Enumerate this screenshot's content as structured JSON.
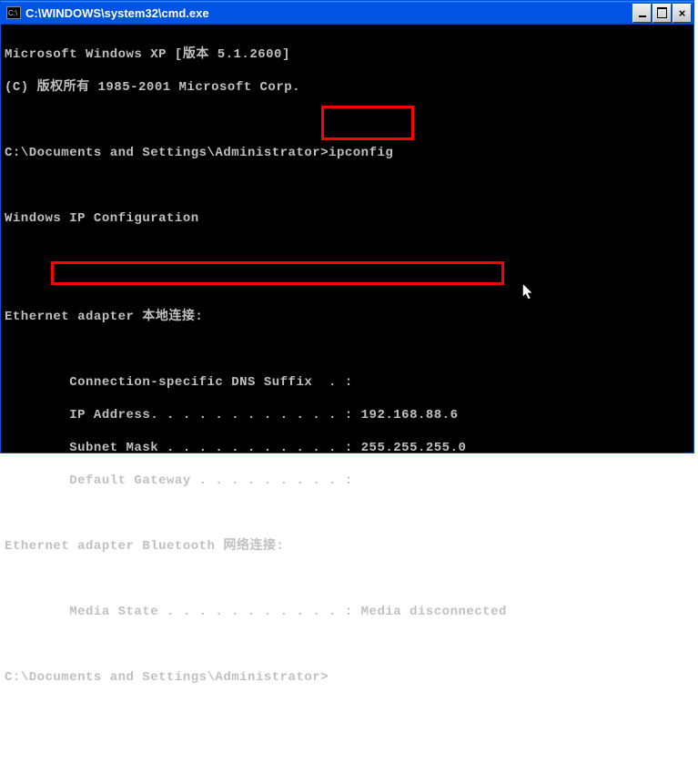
{
  "title": "C:\\WINDOWS\\system32\\cmd.exe",
  "icon_text": "C:\\",
  "header1": "Microsoft Windows XP [版本 5.1.2600]",
  "header2": "(C) 版权所有 1985-2001 Microsoft Corp.",
  "prompt1_path": "C:\\Documents and Settings\\Administrator>",
  "prompt1_cmd": "ipconfig",
  "ipconfig_title": "Windows IP Configuration",
  "adapter1_title": "Ethernet adapter 本地连接:",
  "adapter1_dns": "        Connection-specific DNS Suffix  . :",
  "adapter1_ip": "        IP Address. . . . . . . . . . . . : 192.168.88.6",
  "adapter1_mask": "        Subnet Mask . . . . . . . . . . . : 255.255.255.0",
  "adapter1_gw": "        Default Gateway . . . . . . . . . :",
  "adapter2_title": "Ethernet adapter Bluetooth 网络连接:",
  "adapter2_media": "        Media State . . . . . . . . . . . : Media disconnected",
  "prompt2_path": "C:\\Documents and Settings\\Administrator>"
}
